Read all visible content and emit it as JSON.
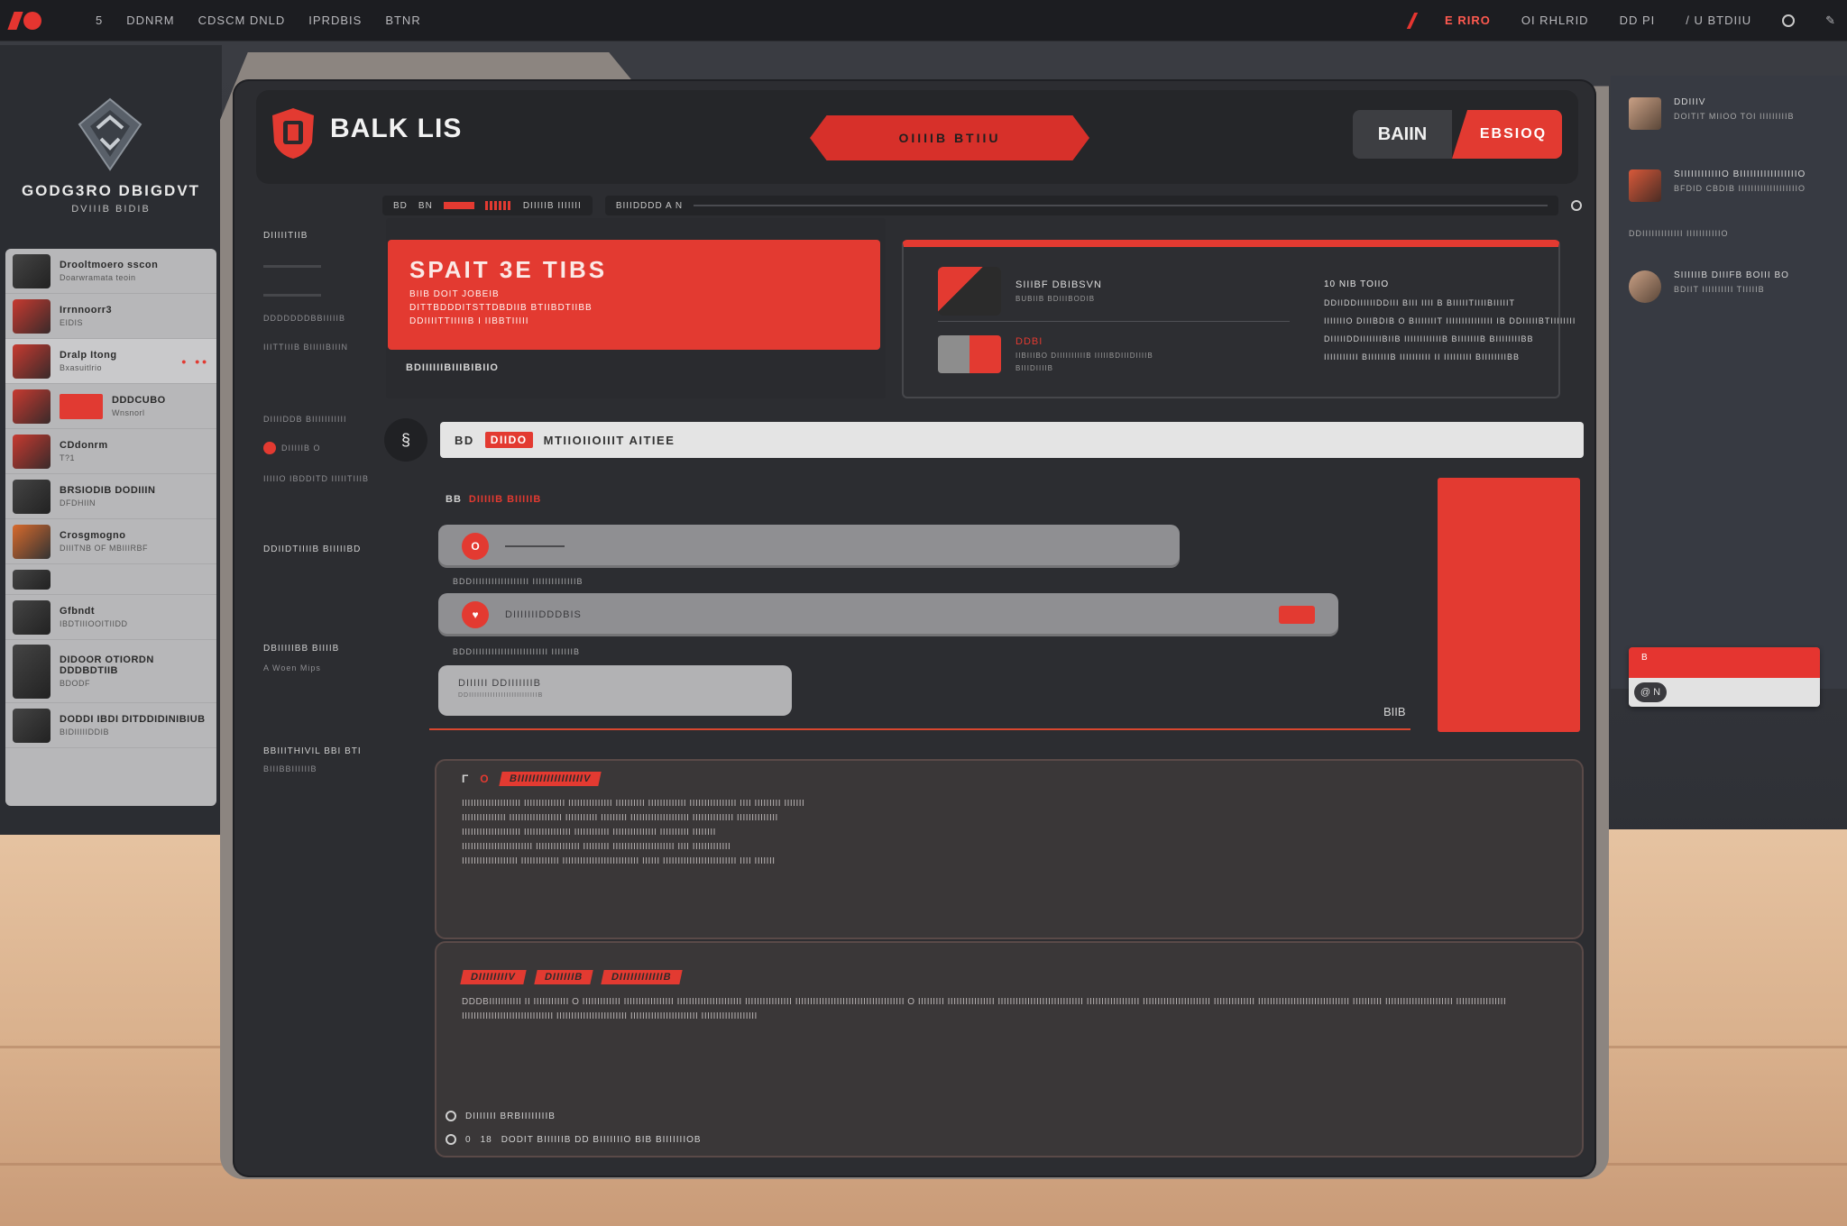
{
  "topbar": {
    "menu": [
      "5",
      "DDNRM",
      "CDSCM DNLD",
      "IPRDBIS",
      "BTNR"
    ],
    "status": "E RIRO",
    "right_items": [
      "OI RHLRID",
      "DD PI",
      "/ U BTDIIU"
    ]
  },
  "brand": {
    "name": "GODG3RO DBIGDVT",
    "subtitle": "DVIIIB BIDIB"
  },
  "user_list": [
    {
      "title": "Drooltmoero sscon",
      "sub": "Doarwramata teoin"
    },
    {
      "title": "Irrnnoorr3",
      "sub": "EIDIS"
    },
    {
      "title": "Dralp Itong",
      "sub": "Bxasuitlrio"
    },
    {
      "title": "DDDCUBO",
      "sub": "Wnsnorl"
    },
    {
      "title": "CDdonrm",
      "sub": "T?1"
    },
    {
      "title": "BRSIODIB DODIIIN",
      "sub": "DFDHIIN"
    },
    {
      "title": "Crosgmogno",
      "sub": "DIIITNB OF MBIIIRBF"
    },
    {
      "title": "",
      "sub": ""
    },
    {
      "title": "Gfbndt",
      "sub": "IBDTIIIOOITIIDD"
    },
    {
      "title": "DIDOOR OTIORDN DDDBDTIIB",
      "sub": "BDODF"
    },
    {
      "title": "DODDI IBDI DITDDIDINIBIUB",
      "sub": "BIDIIIIIDDIB"
    }
  ],
  "header": {
    "title": "BALK LIS",
    "center_button": "OIIIIB BTIIU",
    "toggle_left": "BAIIN",
    "toggle_right": "EBSIOQ"
  },
  "filter": {
    "a": "BD",
    "b": "BN",
    "c": "DIIIIIB IIIIIII",
    "d": "BIIIDDDD A N"
  },
  "side_labels": {
    "l1": "DIIIIITIIB",
    "l2": "DDDDDDDBBIIIIIB",
    "l3": "IIITTIIIB BIIIIIBIIIN",
    "l4": "DIIIIDDB BIIIIIIIIIII",
    "l5": "DIIIIIB O",
    "l6": "IIIIIO IBDDITD IIIIITIIIB",
    "l7": "DDIIDTIIIIB BIIIIIBD",
    "l8": "DBIIIIIBB BIIIIB",
    "l9": "A Woen Mips",
    "l10": "BBIIITHIVIL BBI BTI",
    "l11": "BIIIBBIIIIIIB"
  },
  "start_card": {
    "title": "SPAIT 3E TIBS",
    "line1": "BIIB DOIT JOBEIB",
    "line2": "DITTBDDDITSTTDBDIIB BTIIBDTIIBB",
    "line3": "DDIIIITTIIIIIB I IIBBTIIIII",
    "sub": "BDIIIIIIBIIIBIBIIO"
  },
  "info_card": {
    "row1_title": "SIIIBF DBIBSVN",
    "row1_sub": "BUBIIB BDIIIBODIB",
    "row2_title": "DDBI",
    "row2_sub": "IIBIIIBO DIIIIIIIIIIB IIIIIBDIIIDIIIIB",
    "row2_sub2": "BIIIDIIIIB",
    "right_head": "10 NIB TOIIO",
    "right_lines": [
      "DDIIDDIIIIIIDDIII BIII IIII B BIIIIITIIIIBIIIIIT",
      "IIIIIIIO DIIIBDIB O BIIIIIIIT IIIIIIIIIIIIIII IB DDIIIIIBTIIIIIIII",
      "DIIIIIDDIIIIIIIBIIB IIIIIIIIIIIIB BIIIIIIIB BIIIIIIIIBB",
      "IIIIIIIIIII BIIIIIIIB IIIIIIIIII II IIIIIIIII BIIIIIIIIBB"
    ]
  },
  "search": {
    "prefix": "BD",
    "tag": "DIIDO",
    "text": "MTIIOIIOIIIT AITIEE"
  },
  "form": {
    "title_prefix": "BB",
    "title": "DIIIIIB BIIIIIB",
    "field1_icon": "O",
    "cap1": "BDDIIIIIIIIIIIIIIIIII IIIIIIIIIIIIIIB",
    "field2_placeholder": "DIIIIIIIDDDBIS",
    "cap2": "BDDIIIIIIIIIIIIIIIIIIIIIIII IIIIIIIB",
    "field3_text": "DIIIIII DDIIIIIIIB",
    "field3_sub": "DDIIIIIIIIIIIIIIIIIIIIIIIIIIB",
    "right_label": "BIIB"
  },
  "panel1": {
    "prefix": "Γ",
    "icon": "O",
    "tag": "BIIIIIIIIIIIIIIIIIIV",
    "lines": [
      "IIIIIIIIIIIIIIIIIIII IIIIIIIIIIIIII IIIIIIIIIIIIIII IIIIIIIIII IIIIIIIIIIIII IIIIIIIIIIIIIIII IIII IIIIIIIII IIIIIII",
      "IIIIIIIIIIIIIII IIIIIIIIIIIIIIIIII IIIIIIIIIII IIIIIIIII IIIIIIIIIIIIIIIIIIII IIIIIIIIIIIIII IIIIIIIIIIIIII",
      "IIIIIIIIIIIIIIIIIIII IIIIIIIIIIIIIIII IIIIIIIIIIII IIIIIIIIIIIIIII IIIIIIIIII IIIIIIII",
      "IIIIIIIIIIIIIIIIIIIIIIII IIIIIIIIIIIIIII IIIIIIIII IIIIIIIIIIIIIIIIIIIII IIII IIIIIIIIIIIII",
      "IIIIIIIIIIIIIIIIIII IIIIIIIIIIIII IIIIIIIIIIIIIIIIIIIIIIIIII IIIIII IIIIIIIIIIIIIIIIIIIIIIIII IIII IIIIIII"
    ]
  },
  "panel2": {
    "tag1": "DIIIIIIIIV",
    "tag2": "DIIIIIIB",
    "tag3": "DIIIIIIIIIIIIB",
    "text": "DDDBIIIIIIIIIII II IIIIIIIIIIII O IIIIIIIIIIIII IIIIIIIIIIIIIIIII IIIIIIIIIIIIIIIIIIIIII IIIIIIIIIIIIIIII IIIIIIIIIIIIIIIIIIIIIIIIIIIIIIIIIIIII O IIIIIIIII IIIIIIIIIIIIIIII IIIIIIIIIIIIIIIIIIIIIIIIIIIII IIIIIIIIIIIIIIIIII IIIIIIIIIIIIIIIIIIIIIII IIIIIIIIIIIIII IIIIIIIIIIIIIIIIIIIIIIIIIIIIIII IIIIIIIIII IIIIIIIIIIIIIIIIIIIIIII IIIIIIIIIIIIIIIII IIIIIIIIIIIIIIIIIIIIIIIIIIIIIII IIIIIIIIIIIIIIIIIIIIIIII IIIIIIIIIIIIIIIIIIIIIII IIIIIIIIIIIIIIIIIII",
    "foot1": "DIIIIIII BRBIIIIIIIIB",
    "foot2_a": "0",
    "foot2_b": "18",
    "foot2_text": "DODIT BIIIIIIB DD BIIIIIIIO BIB BIIIIIIIOB"
  },
  "right_panel": {
    "r1_title": "DDIIIV",
    "r1_sub": "DOITIT MIIOO TOI IIIIIIIIIB",
    "r2_title": "SIIIIIIIIIIIIO BIIIIIIIIIIIIIIIIIO",
    "r2_sub": "BFDID CBDIB IIIIIIIIIIIIIIIIIIIO",
    "small": "DDIIIIIIIIIIIII IIIIIIIIIIIO",
    "r3_title": "SIIIIIIB DIIIFB BOIII BO",
    "r3_sub": "BDIIT IIIIIIIIII TIIIIIB",
    "widget_label": "B",
    "widget_pill": "@ N"
  }
}
